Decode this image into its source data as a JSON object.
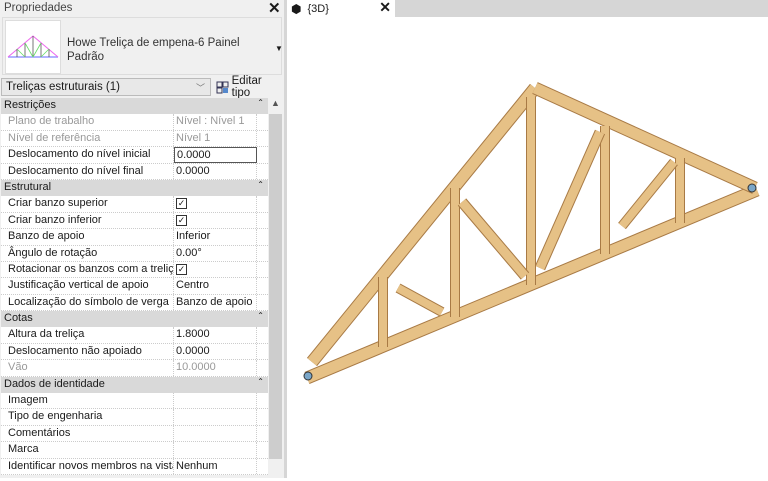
{
  "properties": {
    "title": "Propriedades",
    "type_name": "Howe Treliça de empena-6 Painel",
    "type_sub": "Padrão",
    "category_selector": "Treliças estruturais (1)",
    "edit_type_label": "Editar tipo",
    "groups": [
      {
        "label": "Restrições",
        "rows": [
          {
            "k": "Plano de trabalho",
            "v": "Nível : Nível 1",
            "disabled": true
          },
          {
            "k": "Nível de referência",
            "v": "Nível 1",
            "disabled": true
          },
          {
            "k": "Deslocamento do nível inicial",
            "v": "0.0000",
            "editing": true
          },
          {
            "k": "Deslocamento do nível final",
            "v": "0.0000"
          }
        ]
      },
      {
        "label": "Estrutural",
        "rows": [
          {
            "k": "Criar banzo superior",
            "v": "✓",
            "check": true
          },
          {
            "k": "Criar banzo inferior",
            "v": "✓",
            "check": true
          },
          {
            "k": "Banzo de apoio",
            "v": "Inferior"
          },
          {
            "k": "Ângulo de rotação",
            "v": "0.00°"
          },
          {
            "k": "Rotacionar os banzos com a treliça",
            "v": "✓",
            "check": true
          },
          {
            "k": "Justificação vertical de apoio",
            "v": "Centro"
          },
          {
            "k": "Localização do símbolo de verga",
            "v": "Banzo de apoio"
          }
        ]
      },
      {
        "label": "Cotas",
        "rows": [
          {
            "k": "Altura da treliça",
            "v": "1.8000"
          },
          {
            "k": "Deslocamento não apoiado",
            "v": "0.0000"
          },
          {
            "k": "Vão",
            "v": "10.0000",
            "disabled": true
          }
        ]
      },
      {
        "label": "Dados de identidade",
        "rows": [
          {
            "k": "Imagem",
            "v": ""
          },
          {
            "k": "Tipo de engenharia",
            "v": ""
          },
          {
            "k": "Comentários",
            "v": ""
          },
          {
            "k": "Marca",
            "v": ""
          },
          {
            "k": "Identificar novos membros na vista",
            "v": "Nenhum"
          }
        ]
      }
    ]
  },
  "view": {
    "tab_label": "{3D}"
  },
  "colors": {
    "wood": "#e6c186",
    "wood_edge": "#a87a45"
  }
}
